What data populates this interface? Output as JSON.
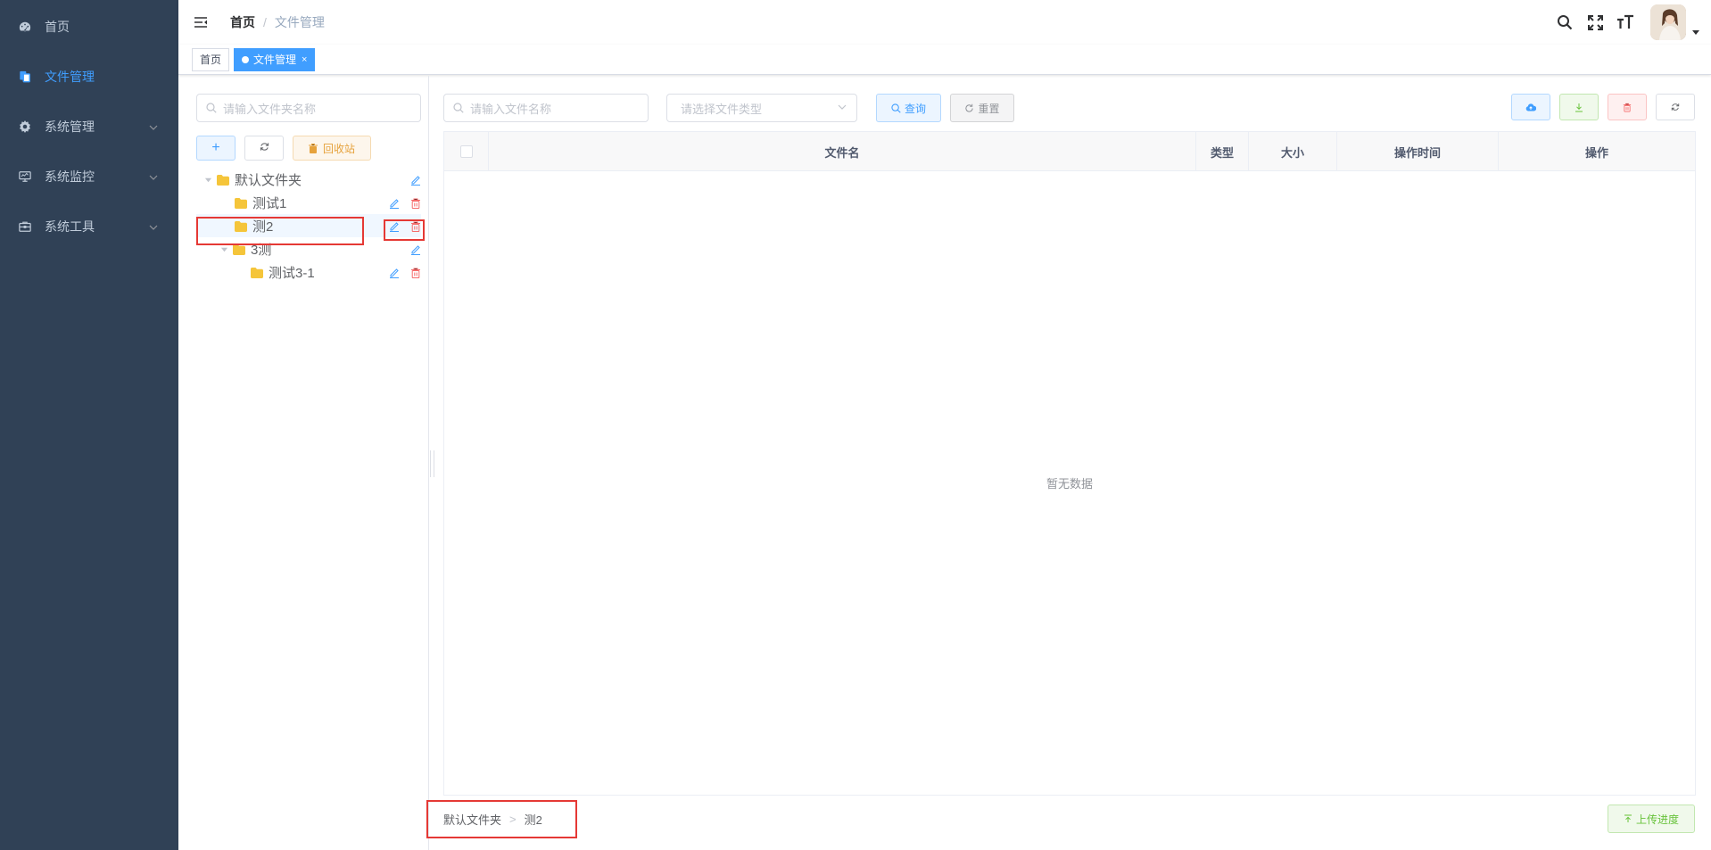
{
  "sidebar": {
    "items": [
      {
        "label": "首页",
        "icon": "dashboard-icon",
        "active": false,
        "expandable": false
      },
      {
        "label": "文件管理",
        "icon": "document-copy-icon",
        "active": true,
        "expandable": false
      },
      {
        "label": "系统管理",
        "icon": "gear-icon",
        "active": false,
        "expandable": true
      },
      {
        "label": "系统监控",
        "icon": "monitor-icon",
        "active": false,
        "expandable": true
      },
      {
        "label": "系统工具",
        "icon": "toolbox-icon",
        "active": false,
        "expandable": true
      }
    ]
  },
  "navbar": {
    "breadcrumb": {
      "home": "首页",
      "separator": "/",
      "current": "文件管理"
    }
  },
  "tags": [
    {
      "label": "首页",
      "active": false
    },
    {
      "label": "文件管理",
      "active": true,
      "close": "×"
    }
  ],
  "folder_panel": {
    "search_placeholder": "请输入文件夹名称",
    "add_label": "+",
    "recycle_label": "回收站",
    "tree": [
      {
        "label": "默认文件夹",
        "depth": 0,
        "expanded": true,
        "deletable": false
      },
      {
        "label": "测试1",
        "depth": 1,
        "expanded": null,
        "deletable": true
      },
      {
        "label": "测2",
        "depth": 1,
        "expanded": null,
        "deletable": true,
        "selected": true
      },
      {
        "label": "3测",
        "depth": 1,
        "expanded": true,
        "deletable": false
      },
      {
        "label": "测试3-1",
        "depth": 2,
        "expanded": null,
        "deletable": true
      }
    ]
  },
  "file_panel": {
    "search_placeholder": "请输入文件名称",
    "type_placeholder": "请选择文件类型",
    "query_label": "查询",
    "reset_label": "重置",
    "columns": [
      "文件名",
      "类型",
      "大小",
      "操作时间",
      "操作"
    ],
    "empty_text": "暂无数据",
    "path": {
      "root": "默认文件夹",
      "separator": ">",
      "current": "测2"
    },
    "progress_label": "上传进度"
  },
  "colors": {
    "sidebar_bg": "#304156",
    "sidebar_text": "#bfcbd9",
    "primary": "#409eff",
    "success": "#67c23a",
    "warning": "#e6a23c",
    "danger": "#f56c6c",
    "highlight_box": "#e53935"
  }
}
